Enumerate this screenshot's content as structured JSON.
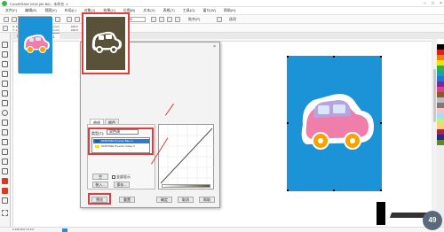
{
  "app": {
    "title": "CorelDRAW 2018 (64 Bit) - 未命名 -1"
  },
  "menu": [
    "文件(F)",
    "编辑(E)",
    "视图(V)",
    "布局(L)",
    "对象(J)",
    "效果(C)",
    "位图(B)",
    "文本(X)",
    "表格(T)",
    "工具(O)",
    "窗口(W)",
    "帮助(H)"
  ],
  "toolbar": {
    "zoom": "39%",
    "snap_label": "贴齐(P)",
    "options_label": "选项"
  },
  "property_bar": {
    "x": "X: 123.892 mm",
    "y": "Y: 1,497.345 mm",
    "w": "210.161 mm",
    "h": "297.071 mm",
    "sx": "100.0",
    "sy": "100.0"
  },
  "doc_tabs": [
    "欢迎屏幕",
    "未命名 -1"
  ],
  "dialog": {
    "title": "双色调",
    "tabs": [
      "曲线",
      "颜色"
    ],
    "type_label": "类型(T):",
    "type_value": "双色调",
    "inks": [
      {
        "name": "PANTONE Process Blue C",
        "color": "#0a5fb4"
      },
      {
        "name": "PANTONE Process Yellow C",
        "color": "#f2e600"
      }
    ],
    "buttons": {
      "load": "装入...",
      "save": "保存...",
      "empty": "空",
      "all_ink": "全部显示",
      "preview": "预览",
      "reset": "重置",
      "ok": "确定",
      "cancel": "取消",
      "help": "帮助"
    },
    "checkbox_all": "全部显示"
  },
  "palette_colors": [
    "#ffffff",
    "#000000",
    "#e02020",
    "#f07f1a",
    "#f5e100",
    "#38b03c",
    "#16a3a3",
    "#2374d6",
    "#6b2fa0",
    "#e33d8b",
    "#8b5a2b",
    "#bdbdbd",
    "#7a7a7a",
    "#ffc0cb",
    "#a0e0ff",
    "#c2f07a",
    "#ffd27a",
    "#aa2244",
    "#2a2a8a",
    "#5c8a2a"
  ],
  "status": {
    "fill_label": "C:100 M:0 Y:0 K:0"
  },
  "logo_text": "49"
}
